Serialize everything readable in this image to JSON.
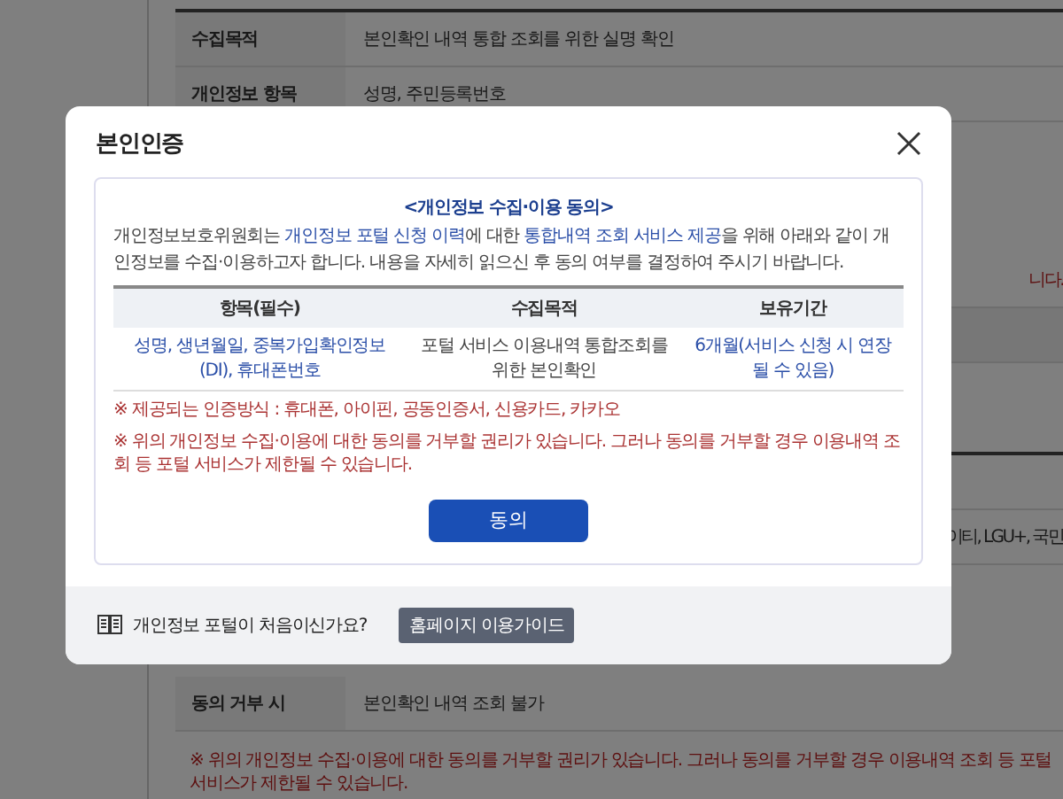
{
  "background": {
    "rows_top": [
      {
        "label": "수집목적",
        "value": "본인확인 내역 통합 조회를 위한 실명 확인"
      },
      {
        "label": "개인정보 항목",
        "value": "성명, 주민등록번호"
      }
    ],
    "fragments": [
      {
        "kind": "notice",
        "text": "니다."
      },
      {
        "kind": "plain",
        "text": "이티, LGU+, 국민"
      }
    ],
    "rows_bottom": [
      {
        "label": "동의 거부 시",
        "value": "본인확인 내역 조회 불가"
      }
    ],
    "notice": "※ 위의 개인정보 수집·이용에 대한 동의를 거부할 권리가 있습니다. 그러나 동의를 거부할 경우 이용내역 조회 등 포털 서비스가 제한될 수 있습니다."
  },
  "modal": {
    "title": "본인인증",
    "heading": "<개인정보 수집·이용 동의>",
    "intro": [
      {
        "text": "개인정보보호위원회는 ",
        "highlight": false
      },
      {
        "text": "개인정보 포털 신청 이력",
        "highlight": true
      },
      {
        "text": "에 대한 ",
        "highlight": false
      },
      {
        "text": "통합내역 조회 서비스 제공",
        "highlight": true
      },
      {
        "text": "을 위해 아래와 같이 개인정보를 수집·이용하고자 합니다. 내용을 자세히 읽으신 후 동의 여부를 결정하여 주시기 바랍니다.",
        "highlight": false
      }
    ],
    "table": {
      "columns": [
        "항목(필수)",
        "수집목적",
        "보유기간"
      ],
      "rows": [
        [
          {
            "text": "성명, 생년월일, 중복가입확인정보(DI), 휴대폰번호",
            "highlight": true
          },
          {
            "text": "포털 서비스 이용내역 통합조회를 위한 본인확인",
            "highlight": false
          },
          {
            "text": "6개월(서비스 신청 시 연장될 수 있음)",
            "highlight": true
          }
        ]
      ]
    },
    "notes": [
      "※ 제공되는 인증방식 : 휴대폰, 아이핀, 공동인증서, 신용카드, 카카오",
      "※ 위의 개인정보 수집·이용에 대한 동의를 거부할 권리가 있습니다. 그러나 동의를 거부할 경우 이용내역 조회 등 포털 서비스가 제한될 수 있습니다."
    ],
    "agree_button": "동의",
    "footer": {
      "question": "개인정보 포털이 처음이신가요?",
      "guide_button": "홈페이지 이용가이드"
    }
  }
}
